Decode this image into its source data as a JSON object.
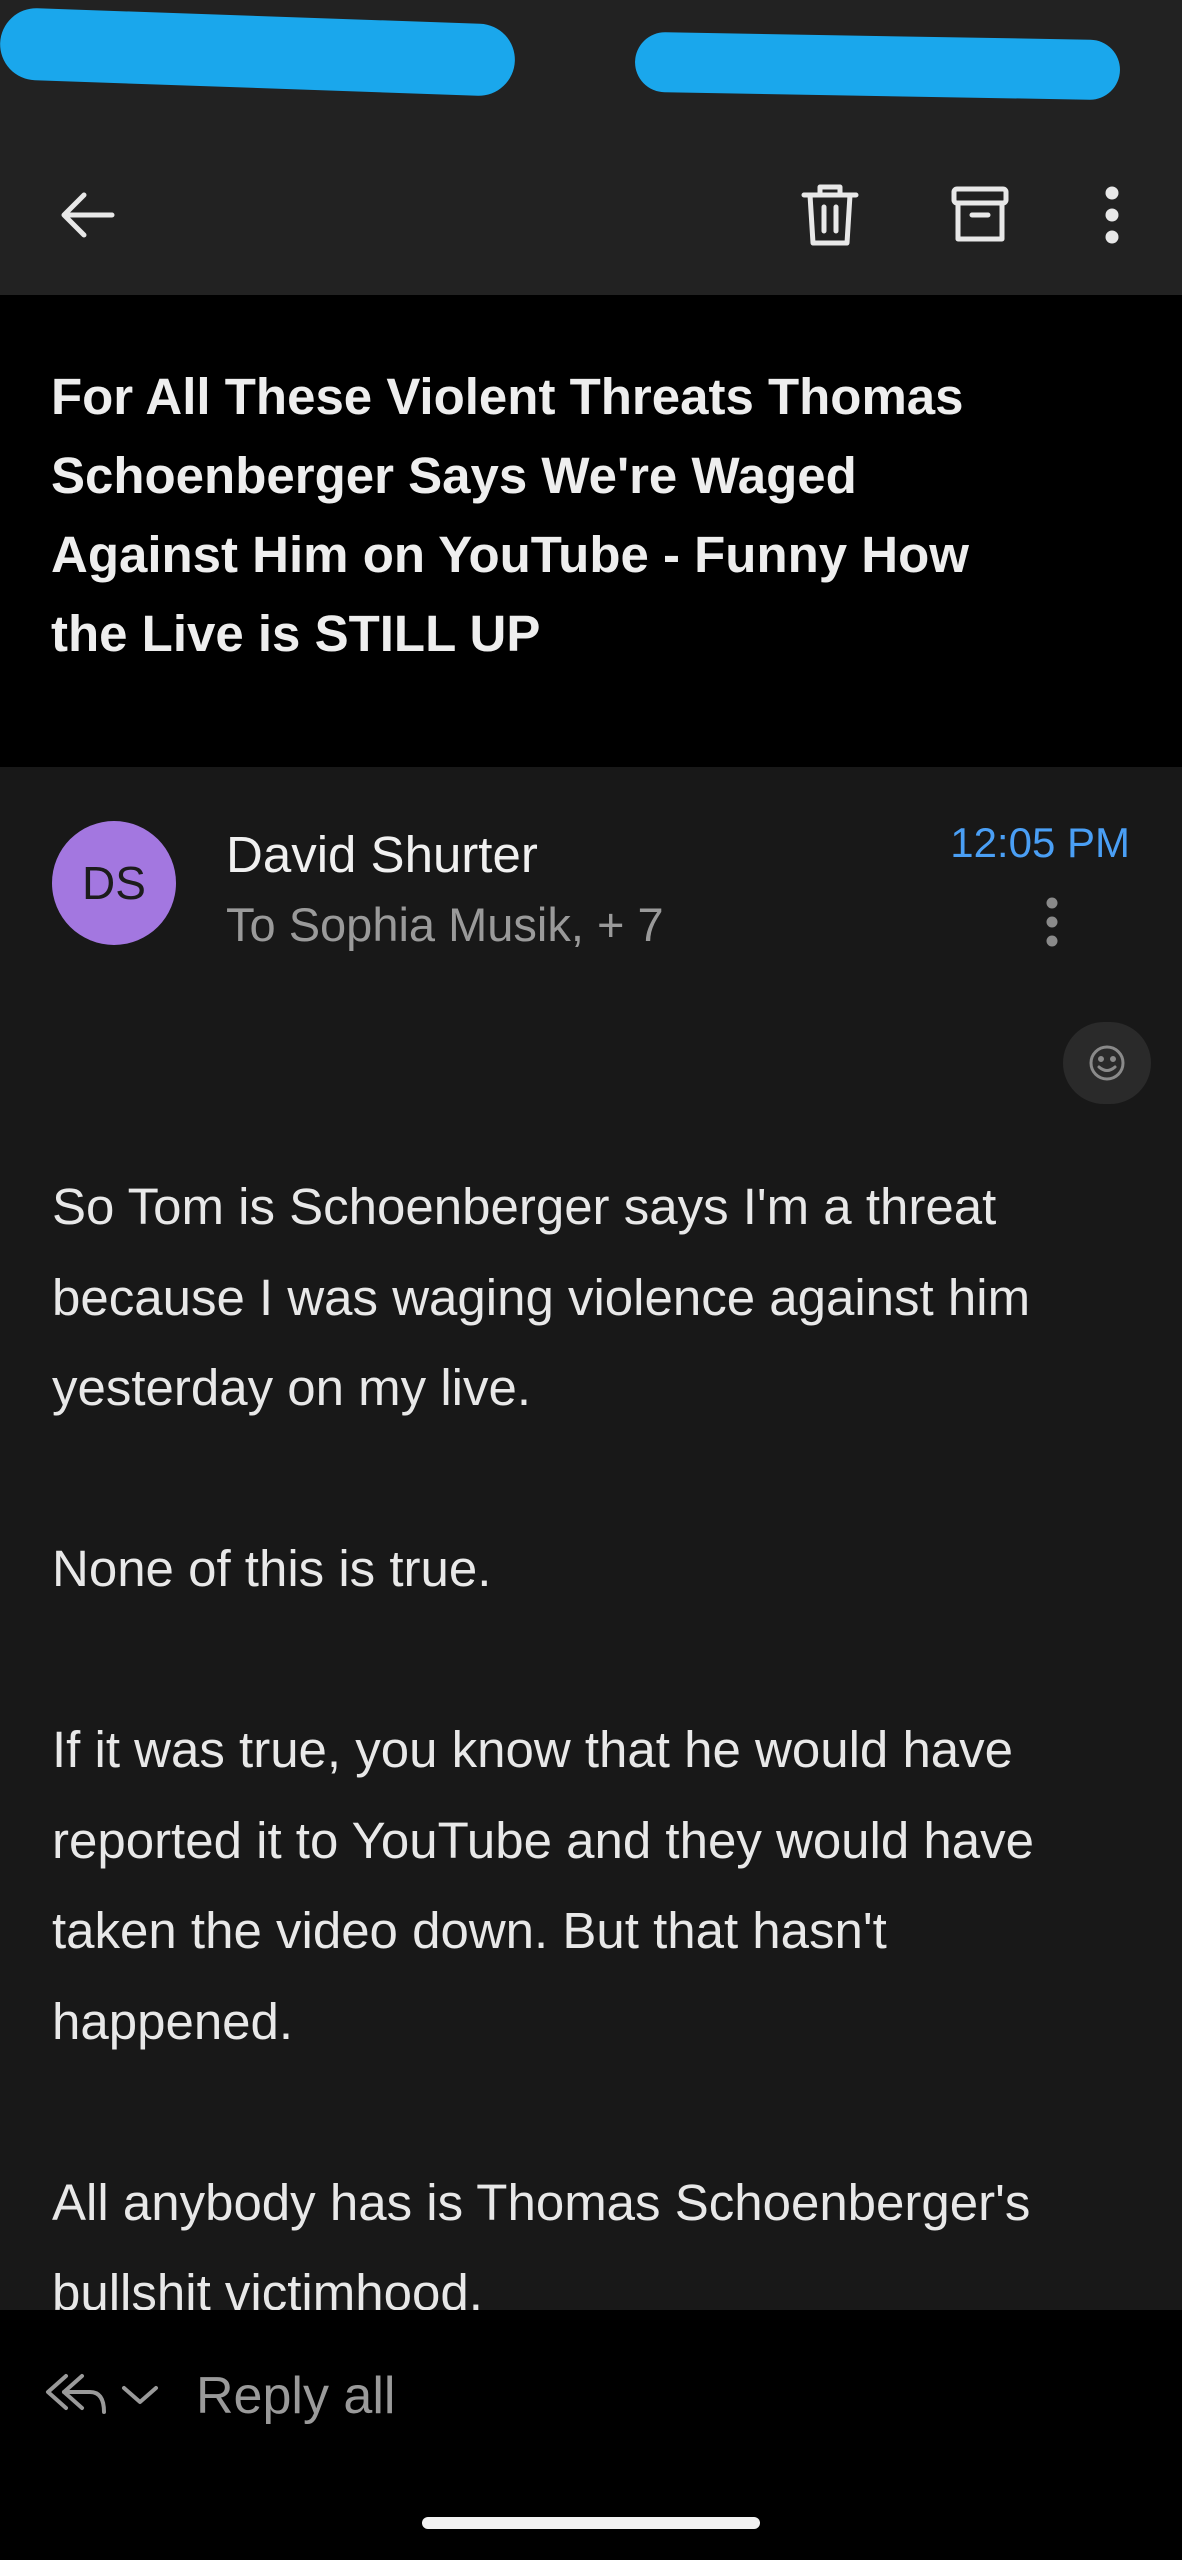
{
  "toolbar": {
    "back_icon": "arrow-left-icon",
    "delete_icon": "trash-icon",
    "archive_icon": "archive-icon",
    "more_icon": "more-vertical-icon"
  },
  "email": {
    "subject": "For All These Violent Threats Thomas Schoenberger Says We're Waged Against Him on YouTube - Funny How the Live is STILL UP",
    "sender_initials": "DS",
    "sender_name": "David Shurter",
    "recipients": "To Sophia Musik, + 7",
    "time": "12:05 PM",
    "body": [
      "So Tom is Schoenberger says I'm a threat because I was waging violence against him yesterday on my live.",
      "None of this is true.",
      "If it was true, you know that he would have reported it to YouTube and they would have taken the video down. But that hasn't happened.",
      "All anybody has is Thomas Schoenberger's bullshit victimhood."
    ]
  },
  "reply_bar": {
    "label": "Reply all"
  },
  "colors": {
    "accent": "#4a9ff5",
    "avatar": "#a377e0",
    "redaction": "#1aa7ec"
  }
}
